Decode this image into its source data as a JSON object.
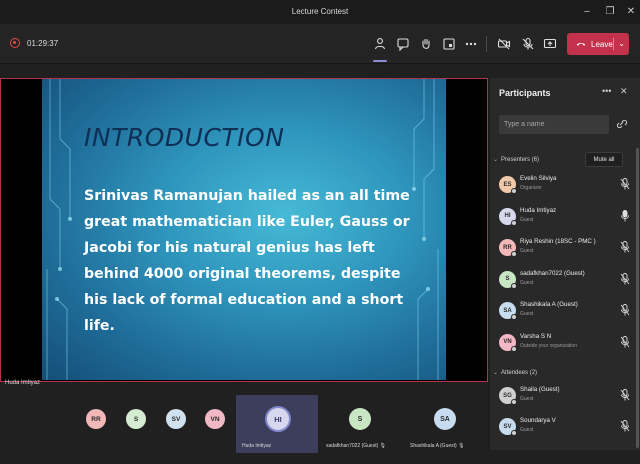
{
  "window": {
    "title": "Lecture Contest"
  },
  "toolbar": {
    "timer": "01:29:37",
    "leave_label": "Leave"
  },
  "slide": {
    "title": "INTRODUCTION",
    "body": "Srinivas Ramanujan hailed as an all time great mathematician like Euler, Gauss or Jacobi for his natural genius has left behind 4000 original theorems, despite his lack of formal education and a short life."
  },
  "stage": {
    "presenter_label": "Huda Imtiyaz"
  },
  "participants": {
    "title": "Participants",
    "search_placeholder": "Type a name",
    "presenters_header": "Presenters (6)",
    "mute_all_label": "Mute all",
    "attendees_header": "Attendees (2)",
    "presenters": [
      {
        "initials": "ES",
        "name": "Evelin Silviya",
        "role": "Organizer",
        "color": "#f1c9a9"
      },
      {
        "initials": "HI",
        "name": "Huda Imtiyaz",
        "role": "Guest",
        "color": "#d7d8ee"
      },
      {
        "initials": "RR",
        "name": "Riya Reshin (18SC - PMC )",
        "role": "Guest",
        "color": "#f2b8b8"
      },
      {
        "initials": "S",
        "name": "sadafkhan7022 (Guest)",
        "role": "Guest",
        "color": "#c9e6c4"
      },
      {
        "initials": "SA",
        "name": "Shashikala A (Guest)",
        "role": "Guest",
        "color": "#c7dcef"
      },
      {
        "initials": "VN",
        "name": "Varsha S N",
        "role": "Outside your organization",
        "color": "#f2b8c6"
      }
    ],
    "attendees": [
      {
        "initials": "SG",
        "name": "Shaila (Guest)",
        "role": "Guest",
        "color": "#cfcfcf"
      },
      {
        "initials": "SV",
        "name": "Soundarya V",
        "role": "Guest",
        "color": "#c7dcef"
      }
    ]
  },
  "strip": {
    "avatars": [
      {
        "initials": "RR",
        "color": "#f2b8b8"
      },
      {
        "initials": "S",
        "color": "#d6ecd2"
      },
      {
        "initials": "SV",
        "color": "#cfe0ef"
      },
      {
        "initials": "VN",
        "color": "#f2b8c6"
      }
    ],
    "tiles": [
      {
        "initials": "HI",
        "name": "Huda Imtiyaz"
      },
      {
        "initials": "S",
        "name": "sadafkhan7022 (Guest)",
        "color": "#c9e6c4"
      },
      {
        "initials": "SA",
        "name": "Shashikala A (Guest)",
        "color": "#c7dcef"
      }
    ]
  }
}
